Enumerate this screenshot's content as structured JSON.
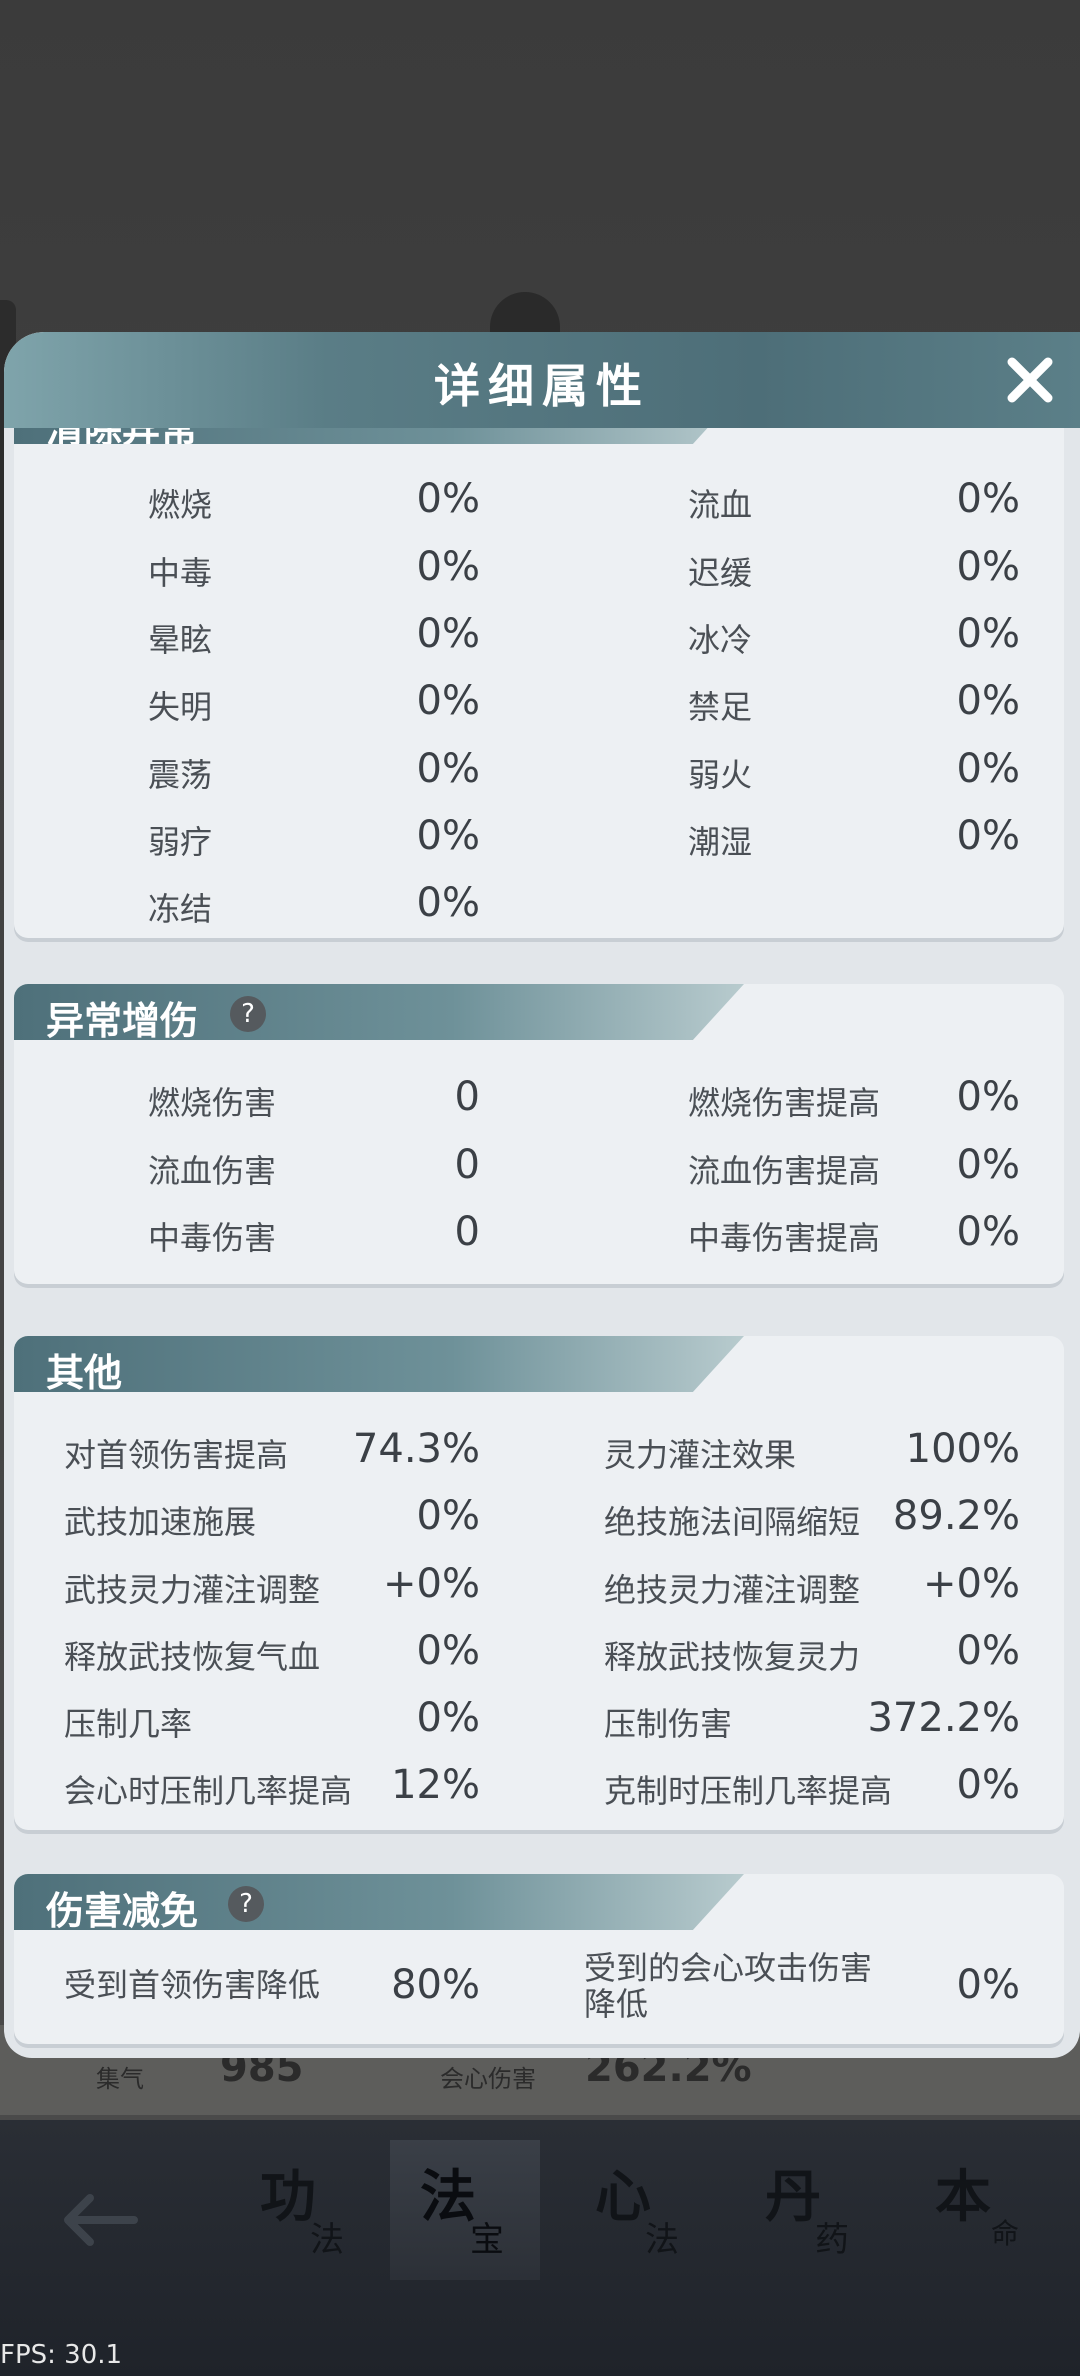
{
  "panel": {
    "title": "详细属性"
  },
  "abnormal_status": {
    "title": "清除异常",
    "left": [
      {
        "label": "燃烧",
        "value": "0%"
      },
      {
        "label": "中毒",
        "value": "0%"
      },
      {
        "label": "晕眩",
        "value": "0%"
      },
      {
        "label": "失明",
        "value": "0%"
      },
      {
        "label": "震荡",
        "value": "0%"
      },
      {
        "label": "弱疗",
        "value": "0%"
      },
      {
        "label": "冻结",
        "value": "0%"
      }
    ],
    "right": [
      {
        "label": "流血",
        "value": "0%"
      },
      {
        "label": "迟缓",
        "value": "0%"
      },
      {
        "label": "冰冷",
        "value": "0%"
      },
      {
        "label": "禁足",
        "value": "0%"
      },
      {
        "label": "弱火",
        "value": "0%"
      },
      {
        "label": "潮湿",
        "value": "0%"
      }
    ]
  },
  "abnormal_damage": {
    "title": "异常增伤",
    "help": "?",
    "left": [
      {
        "label": "燃烧伤害",
        "value": "0"
      },
      {
        "label": "流血伤害",
        "value": "0"
      },
      {
        "label": "中毒伤害",
        "value": "0"
      }
    ],
    "right": [
      {
        "label": "燃烧伤害提高",
        "value": "0%"
      },
      {
        "label": "流血伤害提高",
        "value": "0%"
      },
      {
        "label": "中毒伤害提高",
        "value": "0%"
      }
    ]
  },
  "other": {
    "title": "其他",
    "left": [
      {
        "label": "对首领伤害提高",
        "value": "74.3%"
      },
      {
        "label": "武技加速施展",
        "value": "0%"
      },
      {
        "label": "武技灵力灌注调整",
        "value": "+0%"
      },
      {
        "label": "释放武技恢复气血",
        "value": "0%"
      },
      {
        "label": "压制几率",
        "value": "0%"
      },
      {
        "label": "会心时压制几率提高",
        "value": "12%"
      }
    ],
    "right": [
      {
        "label": "灵力灌注效果",
        "value": "100%"
      },
      {
        "label": "绝技施法间隔缩短",
        "value": "89.2%"
      },
      {
        "label": "绝技灵力灌注调整",
        "value": "+0%"
      },
      {
        "label": "释放武技恢复灵力",
        "value": "0%"
      },
      {
        "label": "压制伤害",
        "value": "372.2%"
      },
      {
        "label": "克制时压制几率提高",
        "value": "0%"
      }
    ]
  },
  "damage_reduction": {
    "title": "伤害减免",
    "help": "?",
    "left": [
      {
        "label": "受到首领伤害降低",
        "value": "80%"
      }
    ],
    "right": [
      {
        "label": "受到的会心攻击伤害降低",
        "value": "0%"
      }
    ]
  },
  "under_stats": {
    "qi_label": "集气",
    "qi_value": "985",
    "crit_label": "会心伤害",
    "crit_value": "262.2%"
  },
  "bottom_nav": {
    "tabs": [
      {
        "big": "功",
        "small": "法"
      },
      {
        "big": "法",
        "small": "宝"
      },
      {
        "big": "心",
        "small": "法"
      },
      {
        "big": "丹",
        "small": "药"
      },
      {
        "big": "本",
        "small": "命"
      }
    ]
  },
  "fps": "FPS: 30.1"
}
